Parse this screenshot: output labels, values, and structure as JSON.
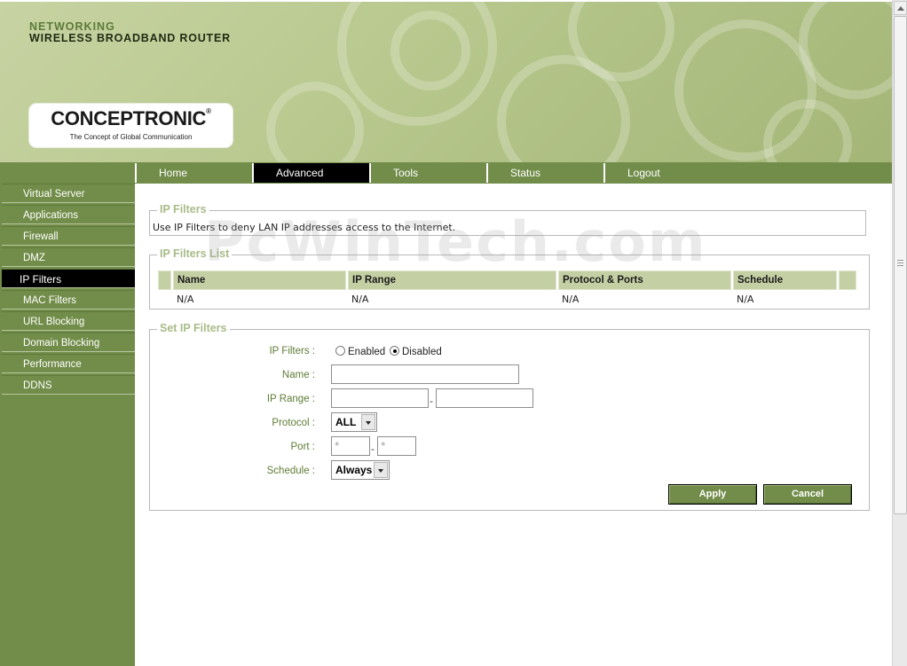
{
  "header": {
    "line1": "NETWORKING",
    "line2": "WIRELESS BROADBAND ROUTER",
    "logo_name": "CONCEPTRONIC",
    "logo_reg": "®",
    "logo_tagline": "The Concept of Global Communication"
  },
  "tabs": [
    {
      "label": "Home"
    },
    {
      "label": "Advanced"
    },
    {
      "label": "Tools"
    },
    {
      "label": "Status"
    },
    {
      "label": "Logout"
    }
  ],
  "active_tab": "Advanced",
  "sidebar": {
    "items": [
      {
        "label": "Virtual Server"
      },
      {
        "label": "Applications"
      },
      {
        "label": "Firewall"
      },
      {
        "label": "DMZ"
      },
      {
        "label": "IP Filters"
      },
      {
        "label": "MAC Filters"
      },
      {
        "label": "URL Blocking"
      },
      {
        "label": "Domain Blocking"
      },
      {
        "label": "Performance"
      },
      {
        "label": "DDNS"
      }
    ],
    "active": "IP Filters"
  },
  "ip_filters": {
    "legend": "IP Filters",
    "description": "Use IP Filters to deny LAN IP addresses access to the Internet."
  },
  "list": {
    "legend": "IP Filters List",
    "columns": [
      "Name",
      "IP Range",
      "Protocol & Ports",
      "Schedule"
    ],
    "rows": [
      [
        "N/A",
        "N/A",
        "N/A",
        "N/A"
      ]
    ]
  },
  "form": {
    "legend": "Set IP Filters",
    "ip_filters_label": "IP Filters :",
    "enabled_label": "Enabled",
    "disabled_label": "Disabled",
    "selected": "Disabled",
    "name_label": "Name :",
    "name_value": "",
    "ip_range_label": "IP Range :",
    "ip_range_dash": "-",
    "ip_start_value": "",
    "ip_end_value": "",
    "protocol_label": "Protocol :",
    "protocol_value": "ALL",
    "port_label": "Port :",
    "port_start_value": "*",
    "port_end_value": "*",
    "port_dash": "-",
    "schedule_label": "Schedule :",
    "schedule_value": "Always",
    "apply_label": "Apply",
    "cancel_label": "Cancel"
  },
  "watermark": "PcWinTech.com",
  "colors": {
    "accent_green": "#728d4a",
    "header_green": "#b9c98f",
    "label_green": "#5e7c35",
    "legend_green": "#a8bb88",
    "table_header": "#c4d0a4",
    "active_black": "#000000"
  }
}
